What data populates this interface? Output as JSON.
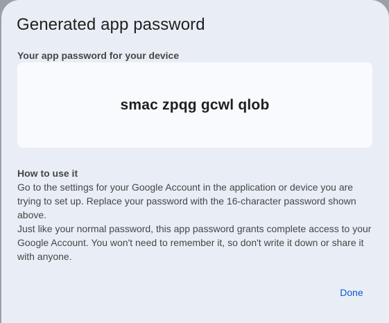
{
  "dialog": {
    "title": "Generated app password",
    "password_label": "Your app password for your device",
    "password_value": "smac zpqg gcwl qlob",
    "howto": {
      "heading": "How to use it",
      "paragraph1": "Go to the settings for your Google Account in the application or device you are trying to set up. Replace your password with the 16-character password shown above.",
      "paragraph2": "Just like your normal password, this app password grants complete access to your Google Account. You won't need to remember it, so don't write it down or share it with anyone."
    },
    "done_label": "Done"
  },
  "colors": {
    "dialog_background": "#e9eef6",
    "password_box_background": "#f8fafd",
    "accent": "#0b57d0",
    "text_primary": "#1f1f1f",
    "text_secondary": "#444746"
  }
}
